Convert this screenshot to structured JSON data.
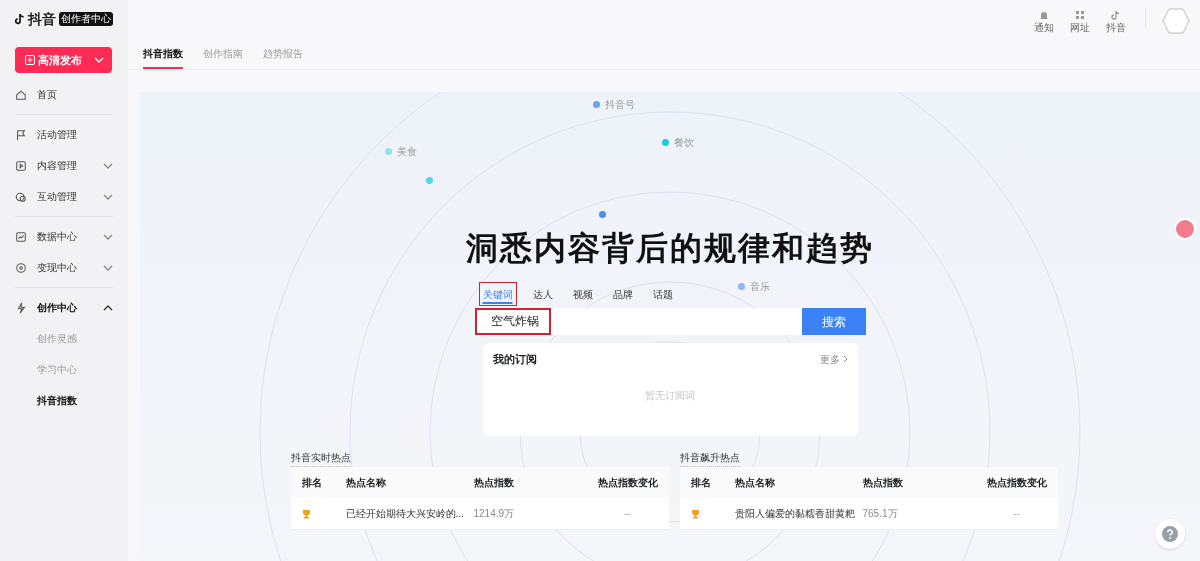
{
  "brand": {
    "name": "抖音",
    "badge": "创作者中心"
  },
  "publish_button": {
    "label": "高清发布"
  },
  "sidebar": {
    "items": [
      {
        "label": "首页",
        "kind": "link",
        "selected": false
      },
      {
        "kind": "divider"
      },
      {
        "label": "活动管理",
        "kind": "link",
        "selected": false
      },
      {
        "label": "内容管理",
        "kind": "group",
        "expanded": false,
        "selected": false
      },
      {
        "label": "互动管理",
        "kind": "group",
        "expanded": false,
        "selected": false
      },
      {
        "kind": "divider"
      },
      {
        "label": "数据中心",
        "kind": "group",
        "expanded": false,
        "selected": false
      },
      {
        "label": "变现中心",
        "kind": "group",
        "expanded": false,
        "selected": false
      },
      {
        "kind": "divider"
      },
      {
        "label": "创作中心",
        "kind": "group",
        "expanded": true,
        "selected": false,
        "children": [
          {
            "label": "创作灵感",
            "selected": false
          },
          {
            "label": "学习中心",
            "selected": false
          },
          {
            "label": "抖音指数",
            "selected": true
          }
        ]
      }
    ]
  },
  "top_icons": [
    {
      "label": "通知"
    },
    {
      "label": "网址"
    },
    {
      "label": "抖音"
    }
  ],
  "tabs": [
    {
      "label": "抖音指数",
      "selected": true
    },
    {
      "label": "创作指南",
      "selected": false
    },
    {
      "label": "趋势报告",
      "selected": false
    }
  ],
  "bubbles": [
    {
      "label": "抖音号",
      "color": "#6aa5f5"
    },
    {
      "label": "餐饮",
      "color": "#1fc9d6"
    },
    {
      "label": "美食",
      "color": "#8fe3ee"
    },
    {
      "label": "音乐",
      "color": "#8ab8f5"
    }
  ],
  "hero_title": "洞悉内容背后的规律和趋势",
  "search_tabs": [
    {
      "label": "关键词",
      "selected": true,
      "highlighted": true
    },
    {
      "label": "达人",
      "selected": false,
      "highlighted": false
    },
    {
      "label": "视频",
      "selected": false,
      "highlighted": false
    },
    {
      "label": "品牌",
      "selected": false,
      "highlighted": false
    },
    {
      "label": "话题",
      "selected": false,
      "highlighted": false
    }
  ],
  "search": {
    "value": "空气炸锅",
    "highlighted": true,
    "button": "搜索"
  },
  "subscription": {
    "title": "我的订阅",
    "more": "更多",
    "empty": "暂无订阅词"
  },
  "hot_lists": [
    {
      "title": "抖音实时热点",
      "columns": [
        "排名",
        "热点名称",
        "热点指数",
        "热点指数变化"
      ],
      "rows": [
        {
          "name": "已经开始期待大兴安岭的...",
          "index": "1214.9万",
          "change": "--"
        }
      ]
    },
    {
      "title": "抖音飙升热点",
      "columns": [
        "排名",
        "热点名称",
        "热点指数",
        "热点指数变化"
      ],
      "rows": [
        {
          "name": "贵阳人偏爱的黏糯香甜黄粑",
          "index": "765.1万",
          "change": "--"
        }
      ]
    }
  ]
}
